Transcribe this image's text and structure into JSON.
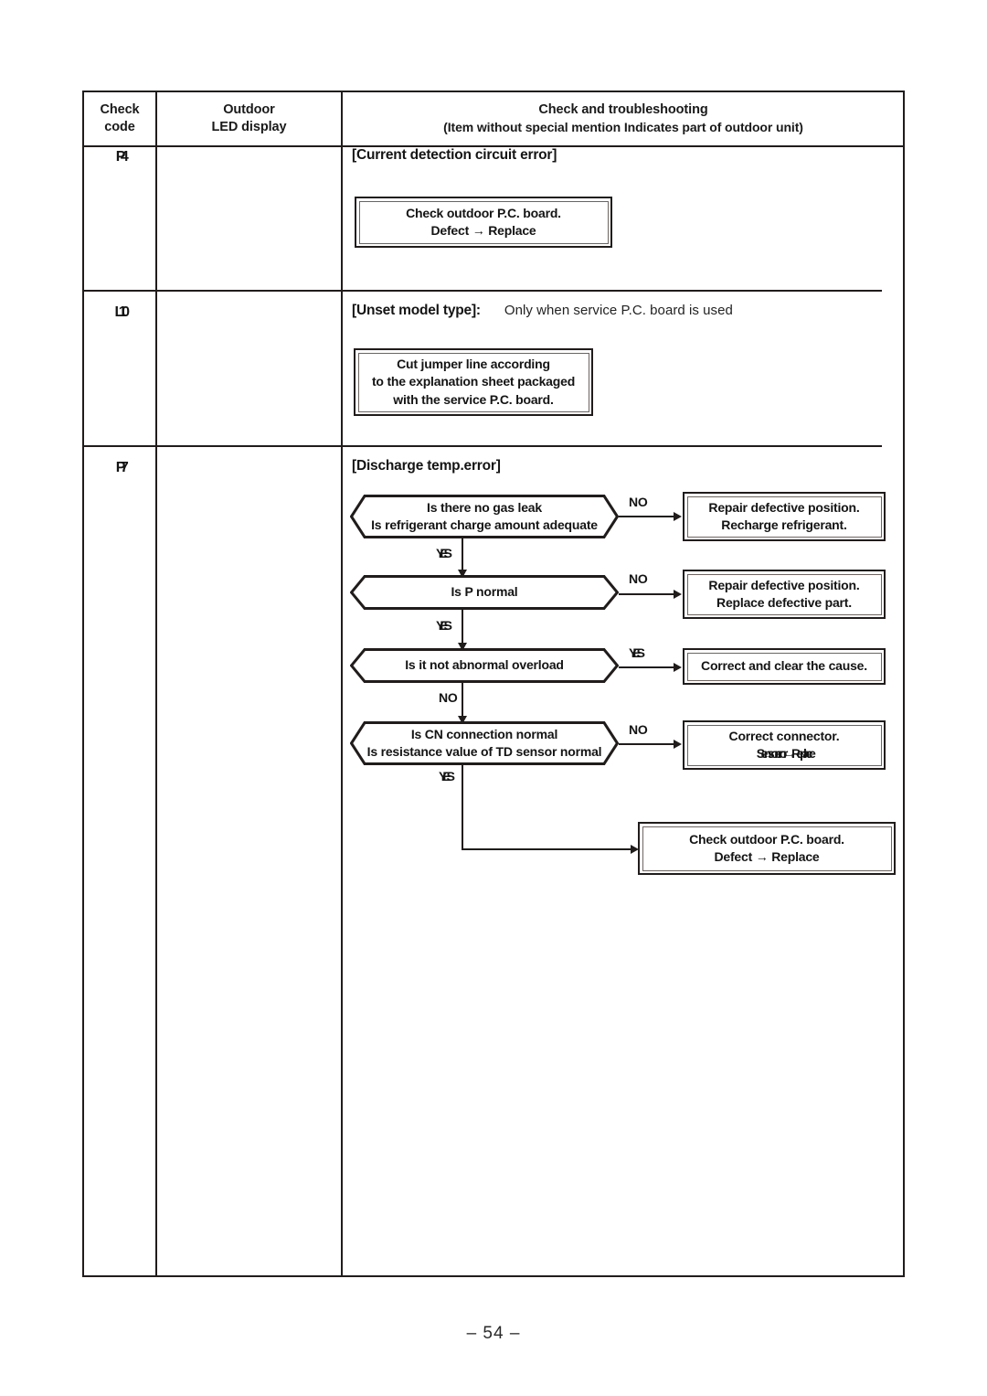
{
  "page": {
    "number_label": "– 54 –"
  },
  "table": {
    "headers": {
      "check_code": [
        "Check",
        "code"
      ],
      "outdoor_led": [
        "Outdoor",
        "LED display"
      ],
      "troubleshooting_title": "Check and troubleshooting",
      "troubleshooting_sub": "(Item without special mention Indicates part of outdoor unit)"
    },
    "rows": [
      {
        "check_code": "P4",
        "led_display": "",
        "title": "[Current detection circuit error]",
        "boxes": [
          {
            "name": "check-outdoor-pc-board-box",
            "lines": [
              "Check outdoor P.C. board.",
              "Defect → Replace"
            ]
          }
        ]
      },
      {
        "check_code": "L10",
        "led_display": "",
        "title": "[Unset model type]:",
        "note": "Only when service P.C. board is used",
        "boxes": [
          {
            "name": "cut-jumper-line-box",
            "lines": [
              "Cut jumper line according",
              "to the explanation sheet packaged",
              "with the service P.C. board."
            ]
          }
        ]
      },
      {
        "check_code": "P7",
        "led_display": "",
        "title": "[Discharge temp.error]",
        "flowchart": {
          "decisions": [
            {
              "id": "gas-leak",
              "lines": [
                "Is there no gas leak",
                "Is refrigerant charge amount adequate"
              ],
              "branch_label": "NO",
              "pass_label": "YES"
            },
            {
              "id": "p-normal",
              "lines": [
                "Is P normal"
              ],
              "branch_label": "NO",
              "pass_label": "YES"
            },
            {
              "id": "abnormal-overload",
              "lines": [
                "Is it not abnormal overload"
              ],
              "branch_label": "YES",
              "pass_label": "NO"
            },
            {
              "id": "cn-connection",
              "lines": [
                "Is CN connection normal",
                "Is resistance value of TD sensor normal"
              ],
              "branch_label": "NO",
              "pass_label": "YES"
            }
          ],
          "actions": [
            {
              "id": "repair-recharge",
              "lines": [
                "Repair defective position.",
                "Recharge refrigerant."
              ]
            },
            {
              "id": "repair-replace-part",
              "lines": [
                "Repair defective position.",
                "Replace defective part."
              ]
            },
            {
              "id": "correct-clear-cause",
              "lines": [
                "Correct and clear the cause."
              ]
            },
            {
              "id": "correct-connector",
              "lines": [
                "Correct connector.",
                "Sensor error → Replace"
              ]
            },
            {
              "id": "check-outdoor-pc-board",
              "lines": [
                "Check outdoor P.C. board.",
                "Defect → Replace"
              ]
            }
          ]
        }
      }
    ]
  }
}
